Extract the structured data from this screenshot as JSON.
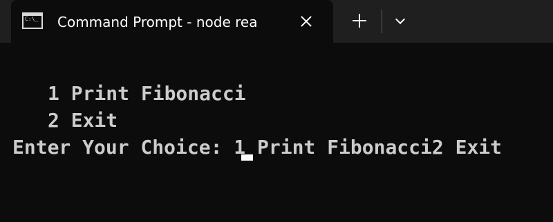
{
  "window": {
    "tab_title": "Command Prompt - node  rea",
    "icon": "cmd-icon"
  },
  "terminal": {
    "lines": [
      "1 Print Fibonacci",
      "2 Exit",
      "Enter Your Choice: 1 Print Fibonacci2 Exit"
    ]
  },
  "colors": {
    "background": "#0c0c0c",
    "tabbar": "#1f1f1f",
    "text": "#cccccc"
  }
}
